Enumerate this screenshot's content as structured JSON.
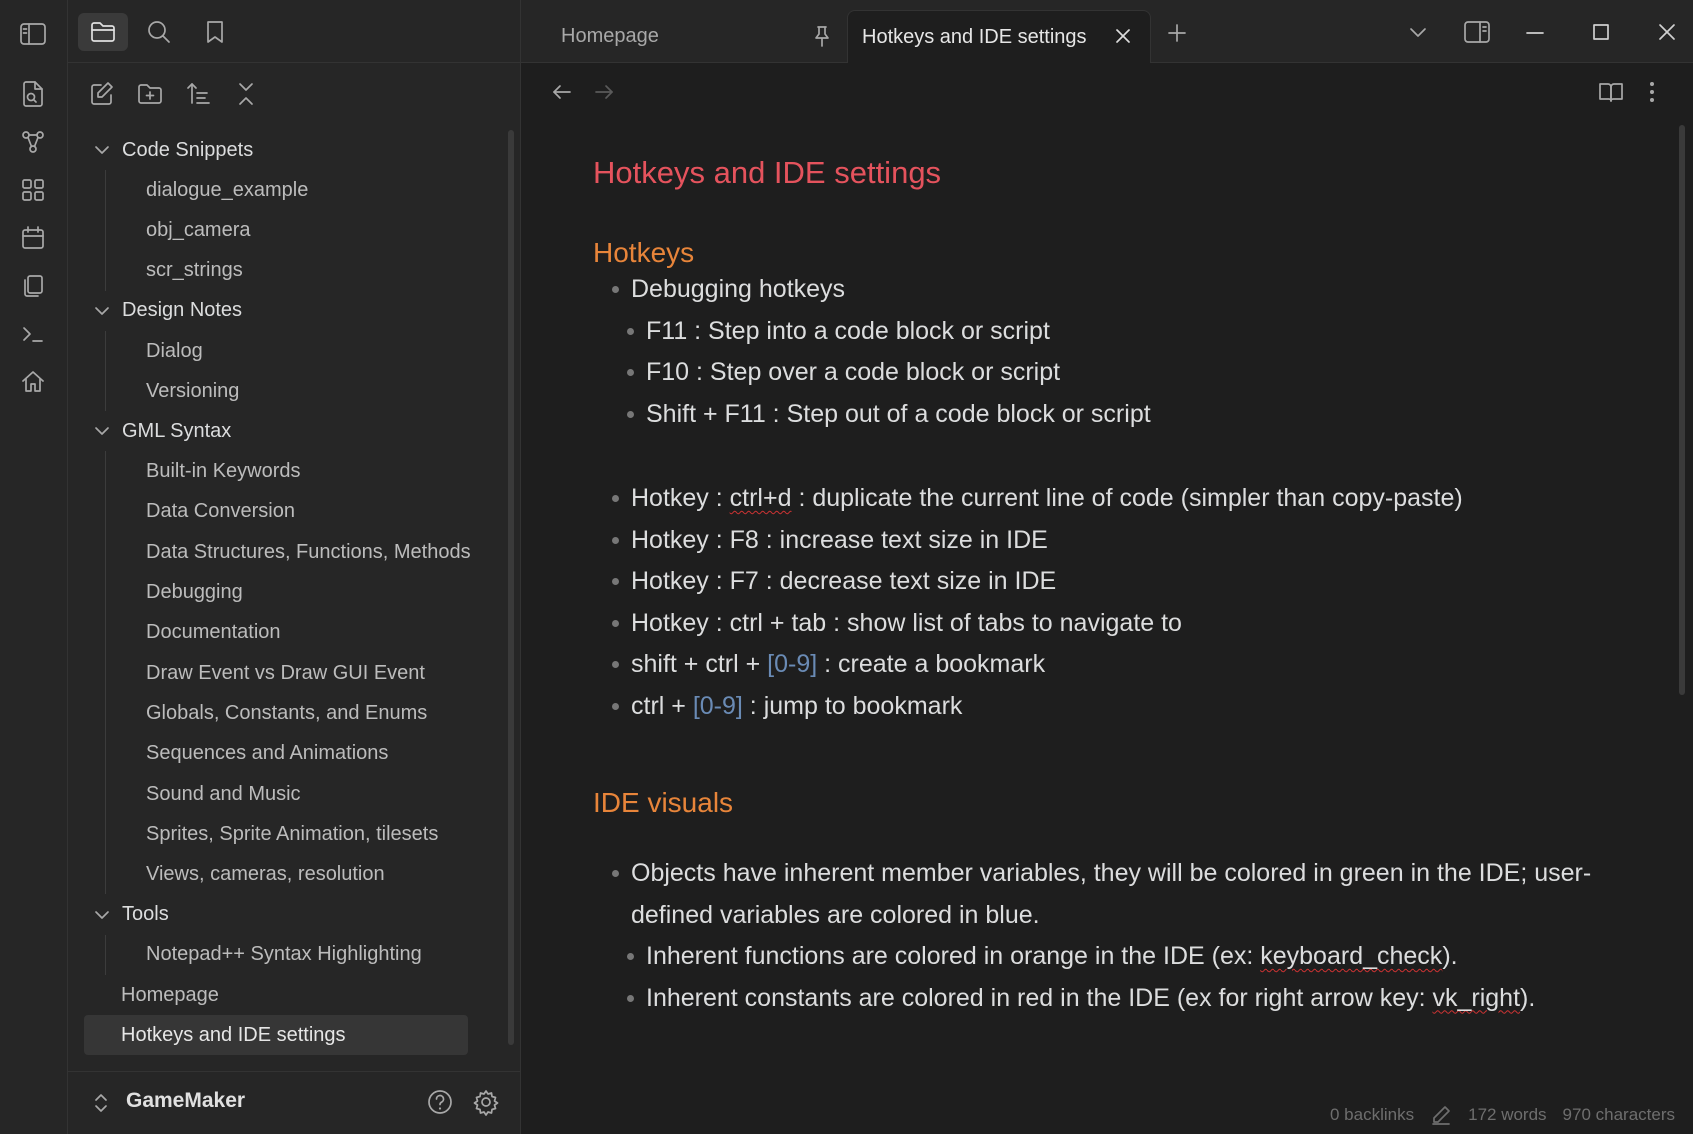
{
  "colors": {
    "accent_heading1": "#e5535d",
    "accent_heading2": "#e8853a",
    "bracket_blue": "#6a8bb5",
    "background": "#1e1e1e",
    "sidebar": "#262626"
  },
  "ribbon": {
    "icons": [
      "sidebar-toggle-icon",
      "open-quick-switcher-icon",
      "graph-view-icon",
      "canvas-icon",
      "daily-note-icon",
      "templates-icon",
      "command-palette-icon",
      "homepage-icon"
    ]
  },
  "sidebar": {
    "top_icons": [
      "folder-icon",
      "search-icon",
      "bookmark-icon"
    ],
    "action_icons": [
      "new-note-icon",
      "new-folder-icon",
      "sort-icon",
      "collapse-all-icon"
    ],
    "tree": [
      {
        "name": "Code Snippets",
        "files": [
          "dialogue_example",
          "obj_camera",
          "scr_strings"
        ]
      },
      {
        "name": "Design Notes",
        "files": [
          "Dialog",
          "Versioning"
        ]
      },
      {
        "name": "GML Syntax",
        "files": [
          "Built-in Keywords",
          "Data Conversion",
          "Data Structures, Functions, Methods",
          "Debugging",
          "Documentation",
          "Draw Event vs Draw GUI Event",
          "Globals, Constants, and Enums",
          "Sequences and Animations",
          "Sound and Music",
          "Sprites, Sprite Animation, tilesets",
          "Views, cameras, resolution"
        ]
      },
      {
        "name": "Tools",
        "files": [
          "Notepad++ Syntax Highlighting"
        ]
      }
    ],
    "root_files": [
      "Homepage",
      "Hotkeys and IDE settings"
    ],
    "vault": "GameMaker"
  },
  "tabs": [
    {
      "label": "Homepage"
    },
    {
      "label": "Hotkeys and IDE settings"
    }
  ],
  "note": {
    "title": "Hotkeys and IDE settings",
    "h_hotkeys": "Hotkeys",
    "debug_label": "Debugging hotkeys",
    "debug_items": [
      "F11 : Step into a code block or script",
      "F10 : Step over a code block or script",
      "Shift + F11 : Step out of a code block or script"
    ],
    "hotkey_ctrl_d_prefix": "Hotkey : ",
    "hotkey_ctrl_d_key": "ctrl+d",
    "hotkey_ctrl_d_suffix": " : duplicate the current line of code (simpler than copy-paste)",
    "hotkey_f8": "Hotkey : F8 : increase text size in IDE",
    "hotkey_f7": "Hotkey : F7 : decrease text size in IDE",
    "hotkey_tab": "Hotkey : ctrl + tab : show list of tabs to navigate to",
    "bookmark_create_prefix": "shift + ctrl + ",
    "bookmark_create_range": "[0-9]",
    "bookmark_create_suffix": " : create a bookmark",
    "bookmark_jump_prefix": "ctrl + ",
    "bookmark_jump_range": "[0-9]",
    "bookmark_jump_suffix": " : jump to bookmark",
    "h_ide": "IDE visuals",
    "ide_objects": "Objects have inherent member variables, they will be colored in green in the IDE; user-defined variables are colored in blue.",
    "ide_functions_prefix": "Inherent functions are colored in orange in the IDE (ex: ",
    "ide_functions_word": "keyboard_check",
    "ide_functions_suffix": ").",
    "ide_constants_prefix": "Inherent constants are colored in red in the IDE (ex for right arrow key: ",
    "ide_constants_word": "vk_right",
    "ide_constants_suffix": ")."
  },
  "status": {
    "backlinks": "0 backlinks",
    "words": "172 words",
    "characters": "970 characters"
  }
}
